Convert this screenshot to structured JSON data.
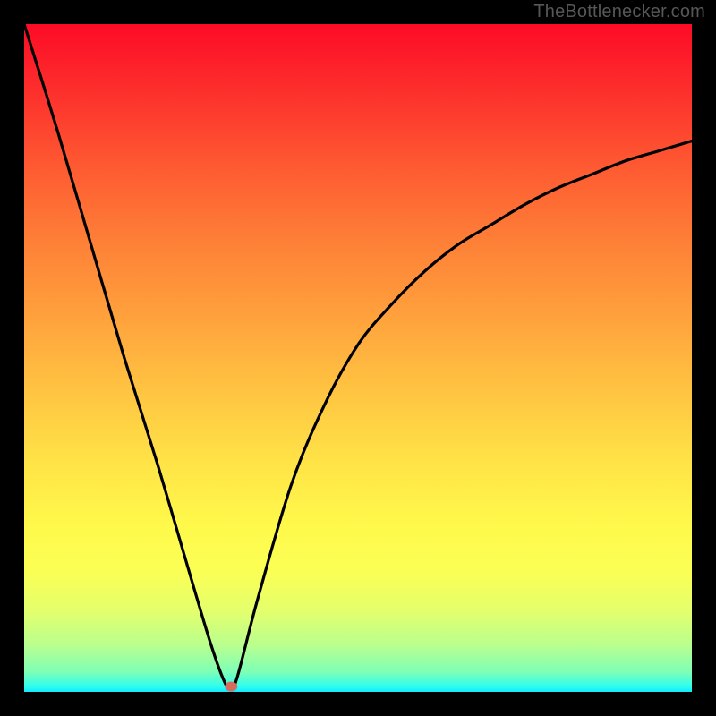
{
  "watermark": "TheBottlenecker.com",
  "chart_data": {
    "type": "line",
    "title": "",
    "xlabel": "",
    "ylabel": "",
    "xlim": [
      0,
      100
    ],
    "ylim": [
      0,
      100
    ],
    "series": [
      {
        "name": "curve",
        "x": [
          0,
          5,
          10,
          15,
          20,
          25,
          28,
          30,
          31,
          32,
          35,
          40,
          45,
          50,
          55,
          60,
          65,
          70,
          75,
          80,
          85,
          90,
          95,
          100
        ],
        "values": [
          100,
          84,
          67,
          50,
          34,
          17,
          7,
          1.5,
          0.5,
          2.5,
          14,
          31,
          43,
          52,
          58,
          63,
          67,
          70,
          73,
          75.5,
          77.5,
          79.5,
          81,
          82.5
        ]
      }
    ],
    "marker": {
      "x": 31.0,
      "y": 0.8
    },
    "gradient_stops": [
      {
        "pct": 0,
        "color": "#fd0b26"
      },
      {
        "pct": 10,
        "color": "#fd2f2c"
      },
      {
        "pct": 22,
        "color": "#fe5c32"
      },
      {
        "pct": 33,
        "color": "#fe8137"
      },
      {
        "pct": 45,
        "color": "#ffa53d"
      },
      {
        "pct": 56,
        "color": "#ffc742"
      },
      {
        "pct": 66,
        "color": "#ffe447"
      },
      {
        "pct": 75,
        "color": "#fff94b"
      },
      {
        "pct": 82,
        "color": "#fbff55"
      },
      {
        "pct": 88,
        "color": "#e3ff6d"
      },
      {
        "pct": 93,
        "color": "#b9ff8e"
      },
      {
        "pct": 97,
        "color": "#7effb6"
      },
      {
        "pct": 99.3,
        "color": "#2bfdf0"
      },
      {
        "pct": 100,
        "color": "#12e8ff"
      }
    ]
  }
}
